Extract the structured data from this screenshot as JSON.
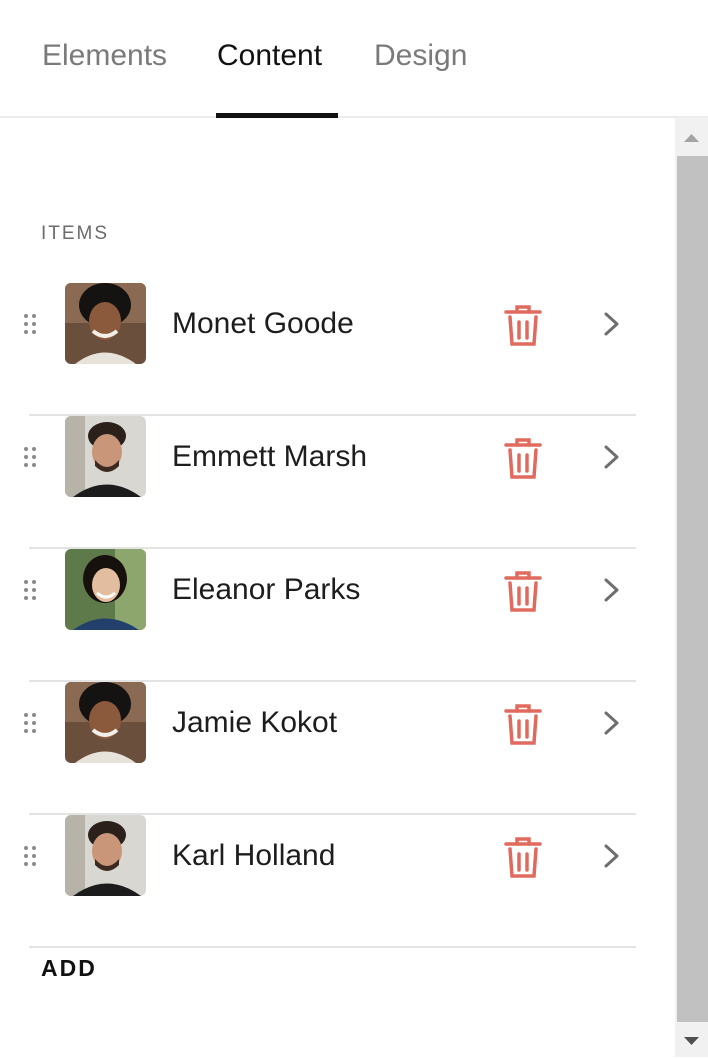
{
  "tabs": [
    {
      "label": "Elements",
      "active": false
    },
    {
      "label": "Content",
      "active": true
    },
    {
      "label": "Design",
      "active": false
    }
  ],
  "section_label": "ITEMS",
  "items": [
    {
      "name": "Monet Goode",
      "avatar": "woman-curly-hair-smiling"
    },
    {
      "name": "Emmett Marsh",
      "avatar": "man-glasses-beard"
    },
    {
      "name": "Eleanor Parks",
      "avatar": "woman-dark-hair-smiling"
    },
    {
      "name": "Jamie Kokot",
      "avatar": "woman-curly-hair-smiling"
    },
    {
      "name": "Karl Holland",
      "avatar": "man-glasses-beard"
    }
  ],
  "add_label": "ADD",
  "colors": {
    "accent": "#111111",
    "trash": "#e06a5e",
    "chevron": "#6e6e6e",
    "scroll_thumb": "#c1c1c1"
  },
  "icons": {
    "drag": "drag-handle-icon",
    "trash": "trash-icon",
    "chevron": "chevron-right-icon",
    "scroll_up": "scroll-up-arrow-icon",
    "scroll_down": "scroll-down-arrow-icon"
  }
}
